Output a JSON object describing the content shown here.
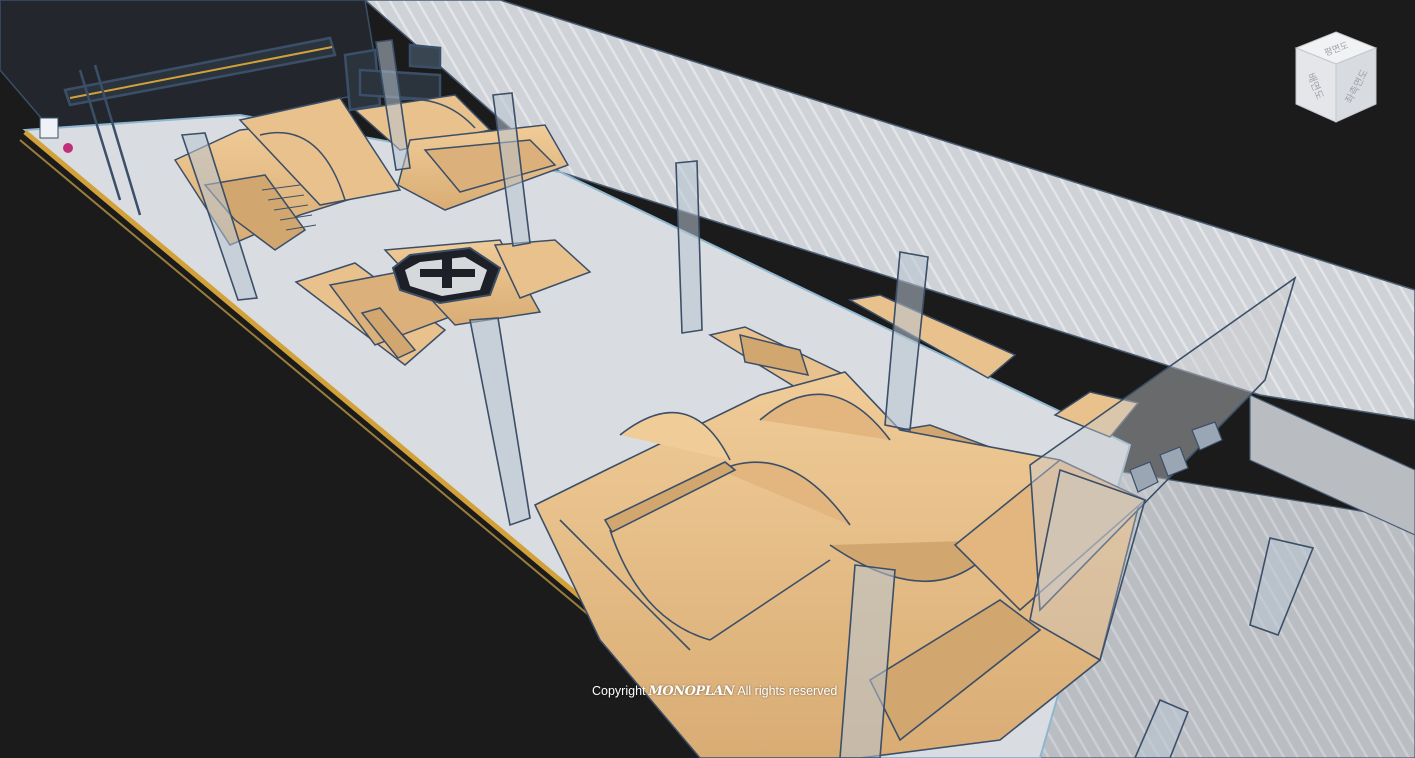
{
  "viewer": {
    "nav_cube": {
      "faces": {
        "top": "평면도",
        "front": "배면도",
        "right": "좌측면도"
      }
    },
    "footer": {
      "copyright_prefix": "Copyright",
      "brand": "MONOPLAN",
      "rights": "All rights reserved"
    }
  },
  "colors": {
    "background": "#1b1b1b",
    "floor": "#d9dde1",
    "ramp": "#e8c18d",
    "ramp_shade": "#d2a66f",
    "edge": "#3b4f68",
    "accent_stripe": "#d2a13a",
    "glass_wall": "#c9ccd1",
    "pillar": "#b8c4d2"
  }
}
